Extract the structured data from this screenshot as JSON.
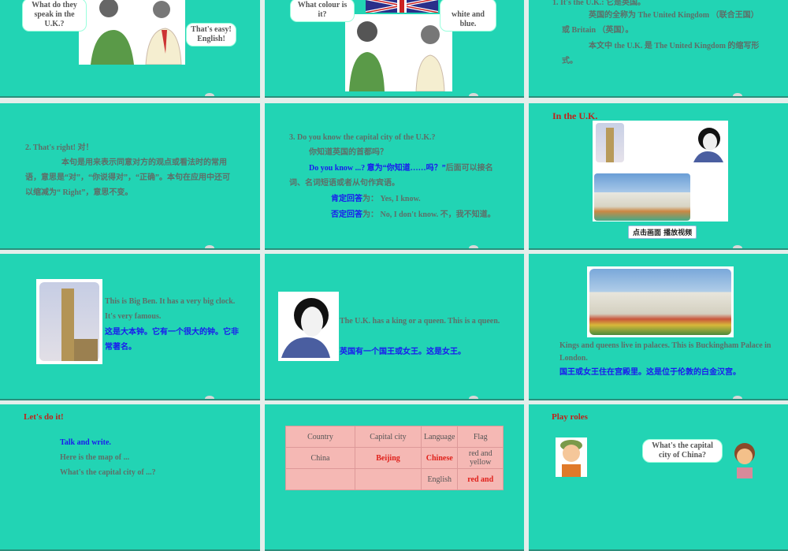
{
  "slides": {
    "s1": {
      "bubble1": "What do they speak in the U.K.?",
      "bubble2": "That's easy! English!"
    },
    "s2": {
      "bubble1": "What colour is it?",
      "bubble2": "white and blue."
    },
    "s3": {
      "line1": "1. It's the U.K.: 它是英国。",
      "line2": "英国的全称为 The United Kingdom （联合王国）或 Britain （英国）。",
      "line3": "本文中 the U.K. 是 The United Kingdom 的缩写形式。"
    },
    "s4": {
      "heading": "2. That's right!  对！",
      "body": "本句是用来表示同意对方的观点或看法时的常用语，意思是“对”，“你说得对”，“正确”。本句在应用中还可以缩减为“ Right”，意思不变。"
    },
    "s5": {
      "line1": "3. Do you know the capital city of the U.K.?",
      "line2": "你知道英国的首都吗？",
      "line3_blue": "Do you know ...?  意为“你知道……吗？”",
      "line3_rest": "后面可以接名词、名词短语或者从句作宾语。",
      "yes_label": "肯定回答",
      "yes_text": "为：  Yes, I know.",
      "no_label": "否定回答",
      "no_text": "为：  No, I don't know. 不，我不知道。"
    },
    "s6": {
      "title": "In the U.K.",
      "button": "点击画面  播放视频"
    },
    "s7": {
      "en": "This is Big Ben. It has a very big clock. It's very famous.",
      "zh": "这是大本钟。它有一个很大的钟。它非常著名。"
    },
    "s8": {
      "en": "The U.K. has a king or a queen. This is a queen.",
      "zh": "英国有一个国王或女王。这是女王。"
    },
    "s9": {
      "en": "Kings and queens live in palaces. This is Buckingham Palace in London.",
      "zh": "国王或女王住在宫殿里。这是位于伦敦的白金汉宫。"
    },
    "s10": {
      "title": "Let's do it!",
      "sub": "Talk and write.",
      "line1": "Here is the map of ...",
      "line2": "What's the capital city of ...?"
    },
    "s11": {
      "headers": [
        "Country",
        "Capital city",
        "Language",
        "Flag"
      ],
      "rows": [
        [
          "China",
          "Beijing",
          "Chinese",
          "red and yellow"
        ],
        [
          "",
          "",
          "English",
          "red and"
        ]
      ]
    },
    "s12": {
      "title": "Play roles",
      "bubble": "What's the capital city of China?"
    }
  }
}
